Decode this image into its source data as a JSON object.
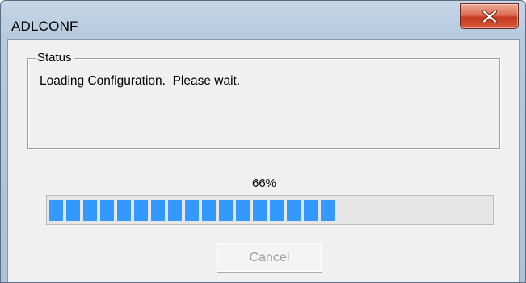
{
  "window": {
    "title": "ADLCONF",
    "close_icon": "close-icon"
  },
  "status_group": {
    "label": "Status",
    "message": "Loading Configuration.  Please wait."
  },
  "progress": {
    "percent_label": "66%",
    "value_percent": 66,
    "fill_color": "#3399ff"
  },
  "buttons": {
    "cancel_label": "Cancel",
    "cancel_enabled": false
  }
}
